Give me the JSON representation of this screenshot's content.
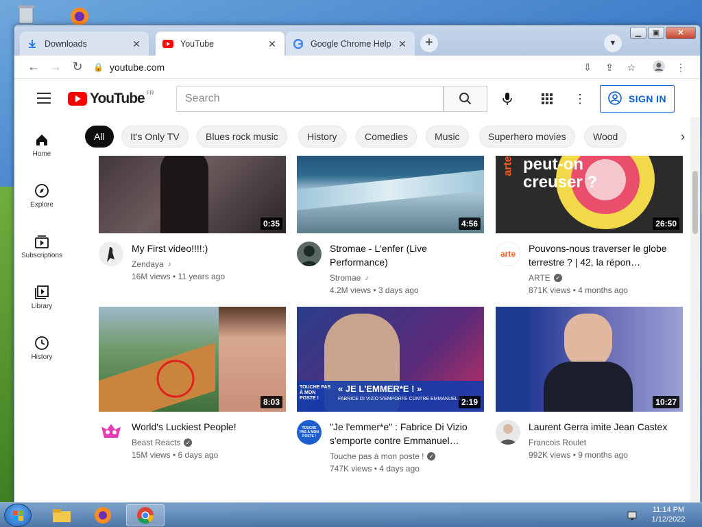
{
  "tabs": [
    {
      "label": "Downloads",
      "icon": "download-icon"
    },
    {
      "label": "YouTube",
      "icon": "youtube-icon",
      "active": true
    },
    {
      "label": "Google Chrome Help",
      "icon": "google-icon"
    }
  ],
  "toolbar": {
    "url": "youtube.com"
  },
  "youtube": {
    "logo_text": "YouTube",
    "region": "FR",
    "search_placeholder": "Search",
    "sign_in": "SIGN IN"
  },
  "guide": [
    {
      "label": "Home",
      "icon": "home-icon"
    },
    {
      "label": "Explore",
      "icon": "compass-icon"
    },
    {
      "label": "Subscriptions",
      "icon": "subscriptions-icon"
    },
    {
      "label": "Library",
      "icon": "library-icon"
    },
    {
      "label": "History",
      "icon": "history-icon"
    }
  ],
  "chips": [
    "All",
    "It's Only TV",
    "Blues rock music",
    "History",
    "Comedies",
    "Music",
    "Superhero movies",
    "Wood"
  ],
  "videos": [
    {
      "title": "My First video!!!!:)",
      "channel": "Zendaya",
      "stats": "16M views • 11 years ago",
      "duration": "0:35"
    },
    {
      "title": "Stromae - L'enfer (Live Performance)",
      "channel": "Stromae",
      "stats": "4.2M views • 3 days ago",
      "duration": "4:56"
    },
    {
      "title": "Pouvons-nous traverser le globe terrestre ? | 42, la répon…",
      "channel": "ARTE",
      "stats": "871K views • 4 months ago",
      "duration": "26:50"
    },
    {
      "title": "World's Luckiest People!",
      "channel": "Beast Reacts",
      "stats": "15M views • 6 days ago",
      "duration": "8:03"
    },
    {
      "title": "\"Je l'emmer*e\" : Fabrice Di Vizio s'emporte contre Emmanuel…",
      "channel": "Touche pas à mon poste !",
      "stats": "747K views • 4 days ago",
      "duration": "2:19"
    },
    {
      "title": "Laurent Gerra imite Jean Castex",
      "channel": "Francois Roulet",
      "stats": "992K views • 9 months ago",
      "duration": "10:27"
    }
  ],
  "thumb_text": {
    "arte_overlay": "peut-on creuser ?",
    "arte_logo": "arte",
    "tpmp_banner": "« JE L'EMMER*E ! »",
    "tpmp_sub": "FABRICE DI VIZIO S'EMPORTE CONTRE EMMANUEL M",
    "tpmp_logo": "TOUCHE PAS À MON POSTE !"
  },
  "clock": {
    "time": "11:14 PM",
    "date": "1/12/2022"
  }
}
